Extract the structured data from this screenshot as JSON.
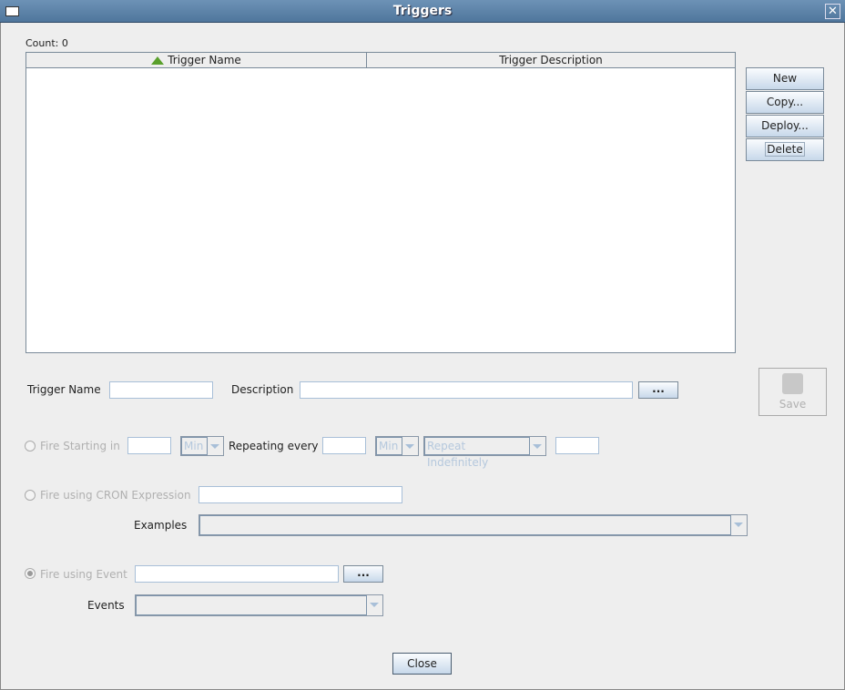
{
  "window": {
    "title": "Triggers"
  },
  "count_label": "Count: 0",
  "table": {
    "columns": [
      "Trigger Name",
      "Trigger Description"
    ],
    "rows": []
  },
  "side_buttons": {
    "new": "New",
    "copy": "Copy...",
    "deploy": "Deploy...",
    "delete": "Delete"
  },
  "form": {
    "trigger_name_label": "Trigger Name",
    "trigger_name_value": "",
    "description_label": "Description",
    "description_value": "",
    "ellipsis": "...",
    "save": "Save",
    "fire_starting_label": "Fire Starting in",
    "start_unit": "Min",
    "repeating_label": "Repeating every",
    "repeat_unit": "Min",
    "repeat_mode": "Repeat Indefinitely",
    "cron_label": "Fire using CRON Expression",
    "examples_label": "Examples",
    "event_label": "Fire using Event",
    "events_label": "Events"
  },
  "close": "Close"
}
